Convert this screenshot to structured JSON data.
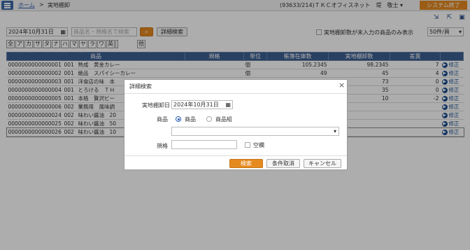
{
  "header": {
    "breadcrumb_home": "ホーム",
    "breadcrumb_sep": ">",
    "page_title": "実地棚卸",
    "user_info": "(93633/214)ＴＫＣオフィスネット　堤　敬士",
    "user_menu_arrow": "▾",
    "exit_button": "システム終了"
  },
  "toolbar_icons": [
    "export-icon",
    "external-window-icon",
    "print-icon",
    "help-icon"
  ],
  "filters": {
    "date": "2024年10月31日",
    "search_placeholder": "商品名・規格名で検索",
    "detail_search": "詳細検索",
    "unentered_only_label": "実地棚卸数が未入力の商品のみ表示",
    "per_page": "50件/頁"
  },
  "kana_tabs": [
    "全",
    "ア",
    "カ",
    "サ",
    "タ",
    "ナ",
    "ハ",
    "マ",
    "ヤ",
    "ラ",
    "ワ",
    "英",
    "他"
  ],
  "table": {
    "headers": {
      "product": "商品",
      "spec": "規格",
      "unit": "単位",
      "book_stock": "帳簿在庫数",
      "actual_count": "実地棚卸数",
      "diff": "差異"
    },
    "edit_label": "修正",
    "rows": [
      {
        "code": "0000000000000001",
        "group": "001",
        "name": "熟成　黄金カレー",
        "spec": "",
        "unit": "個",
        "book": "105.2345",
        "actual": "98.2345",
        "diff": "7"
      },
      {
        "code": "0000000000000002",
        "group": "001",
        "name": "絶品　スパイシーカレー",
        "spec": "",
        "unit": "個",
        "book": "49",
        "actual": "45",
        "diff": "4"
      },
      {
        "code": "0000000000000003",
        "group": "001",
        "name": "洋食店の味　本",
        "spec": "",
        "unit": "",
        "book": "",
        "actual": "73",
        "diff": "0"
      },
      {
        "code": "0000000000000004",
        "group": "001",
        "name": "とろける　ＴＨ",
        "spec": "",
        "unit": "",
        "book": "",
        "actual": "35",
        "diff": "0"
      },
      {
        "code": "0000000000000005",
        "group": "001",
        "name": "本格　贅沢ビー",
        "spec": "",
        "unit": "",
        "book": "",
        "actual": "10",
        "diff": "-2"
      },
      {
        "code": "0000000000000006",
        "group": "002",
        "name": "業務用　風味調",
        "spec": "",
        "unit": "",
        "book": "",
        "actual": "",
        "diff": ""
      },
      {
        "code": "0000000000000024",
        "group": "002",
        "name": "味わい醤油　20",
        "spec": "",
        "unit": "",
        "book": "",
        "actual": "",
        "diff": ""
      },
      {
        "code": "0000000000000025",
        "group": "002",
        "name": "味わい醤油　50",
        "spec": "",
        "unit": "",
        "book": "",
        "actual": "",
        "diff": ""
      },
      {
        "code": "0000000000000026",
        "group": "002",
        "name": "味わい醤油　10",
        "spec": "",
        "unit": "",
        "book": "",
        "actual": "",
        "diff": ""
      }
    ]
  },
  "dialog": {
    "title": "詳細検索",
    "close": "×",
    "date_label": "実地棚卸日",
    "date_value": "2024年10月31日",
    "product_label": "商品",
    "radio_product": "商品",
    "radio_product_group": "商品組",
    "spec_label": "規格",
    "empty_label": "空欄",
    "search_button": "検索",
    "clear_button": "条件取消",
    "cancel_button": "キャンセル"
  }
}
